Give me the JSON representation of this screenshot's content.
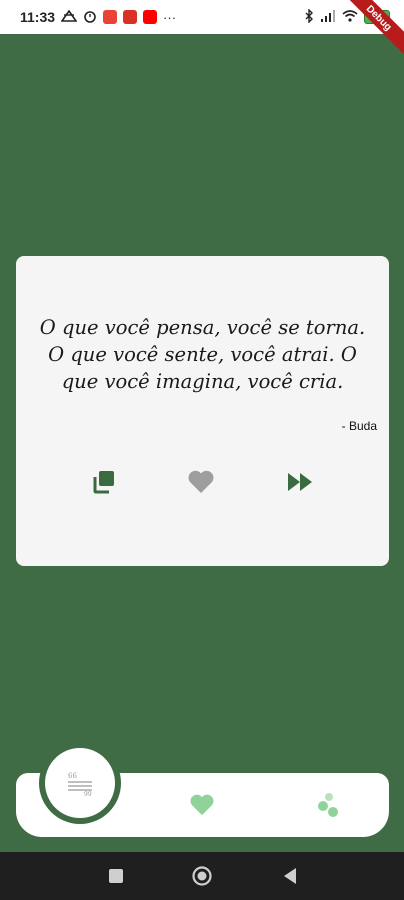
{
  "status_bar": {
    "time": "11:33",
    "battery": "100",
    "more": "···",
    "icons": [
      "network-icon",
      "alarm-icon",
      "gmail-icon",
      "gmail-icon",
      "youtube-icon",
      "bluetooth-icon",
      "signal-icon",
      "wifi-icon",
      "battery-icon"
    ]
  },
  "debug_banner": "Debug",
  "quote": {
    "text": "O que você pensa, você se torna. O que você sente, você atrai. O que você imagina, você cria.",
    "author": "- Buda"
  },
  "actions": {
    "icons": [
      "copy-icon",
      "heart-icon",
      "fast-forward-icon"
    ]
  },
  "bottom_nav": {
    "items": [
      "quotes-icon",
      "favorites-heart-icon",
      "bubbles-icon"
    ]
  },
  "colors": {
    "background": "#3f6b45",
    "card": "#f5f5f5",
    "accent": "#3a6b40",
    "heart_inactive": "#9e9e9e",
    "nav_inactive": "#8fd39a",
    "system_nav": "#1f1f1f"
  }
}
